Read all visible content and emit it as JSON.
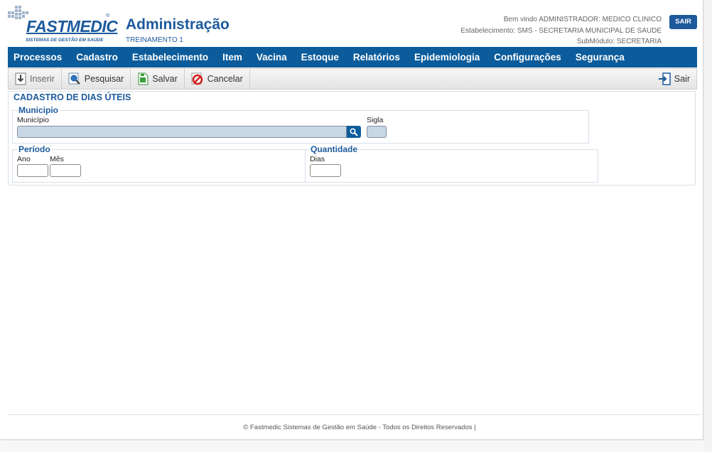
{
  "header": {
    "logo_text": "FASTMEDIC",
    "logo_tagline": "SISTEMAS DE GESTÃO EM SAÚDE",
    "app_title": "Administração",
    "app_subtitle": "TREINAMENTO 1",
    "welcome": "Bem vindo ADMINISTRADOR: MEDICO CLINICO",
    "establishment": "Estabelecimento: SMS - SECRETARIA MUNICIPAL DE SAUDE",
    "submodule": "SubMódulo: SECRETARIA",
    "logout_label": "SAIR"
  },
  "menu": {
    "items": [
      "Processos",
      "Cadastro",
      "Estabelecimento",
      "Item",
      "Vacina",
      "Estoque",
      "Relatórios",
      "Epidemiologia",
      "Configurações",
      "Segurança"
    ]
  },
  "toolbar": {
    "insert_label": "Inserir",
    "search_label": "Pesquisar",
    "save_label": "Salvar",
    "cancel_label": "Cancelar",
    "exit_label": "Sair"
  },
  "form": {
    "title": "CADASTRO DE DIAS ÚTEIS",
    "municipio_section": {
      "legend": "Municipio",
      "municipio_label": "Município",
      "municipio_value": "",
      "sigla_label": "Sigla",
      "sigla_value": ""
    },
    "periodo_section": {
      "legend": "Período",
      "ano_label": "Ano",
      "ano_value": "",
      "mes_label": "Mês",
      "mes_value": ""
    },
    "quantidade_section": {
      "legend": "Quantidade",
      "dias_label": "Dias",
      "dias_value": ""
    }
  },
  "footer": {
    "text": "© Fastmedic Sistemas de Gestão em Saúde - Todos os Direitos Reservados |"
  },
  "colors": {
    "brand_blue": "#1d5a9c",
    "menu_blue": "#0c5c9b",
    "readonly_input": "#c9d6e3"
  }
}
